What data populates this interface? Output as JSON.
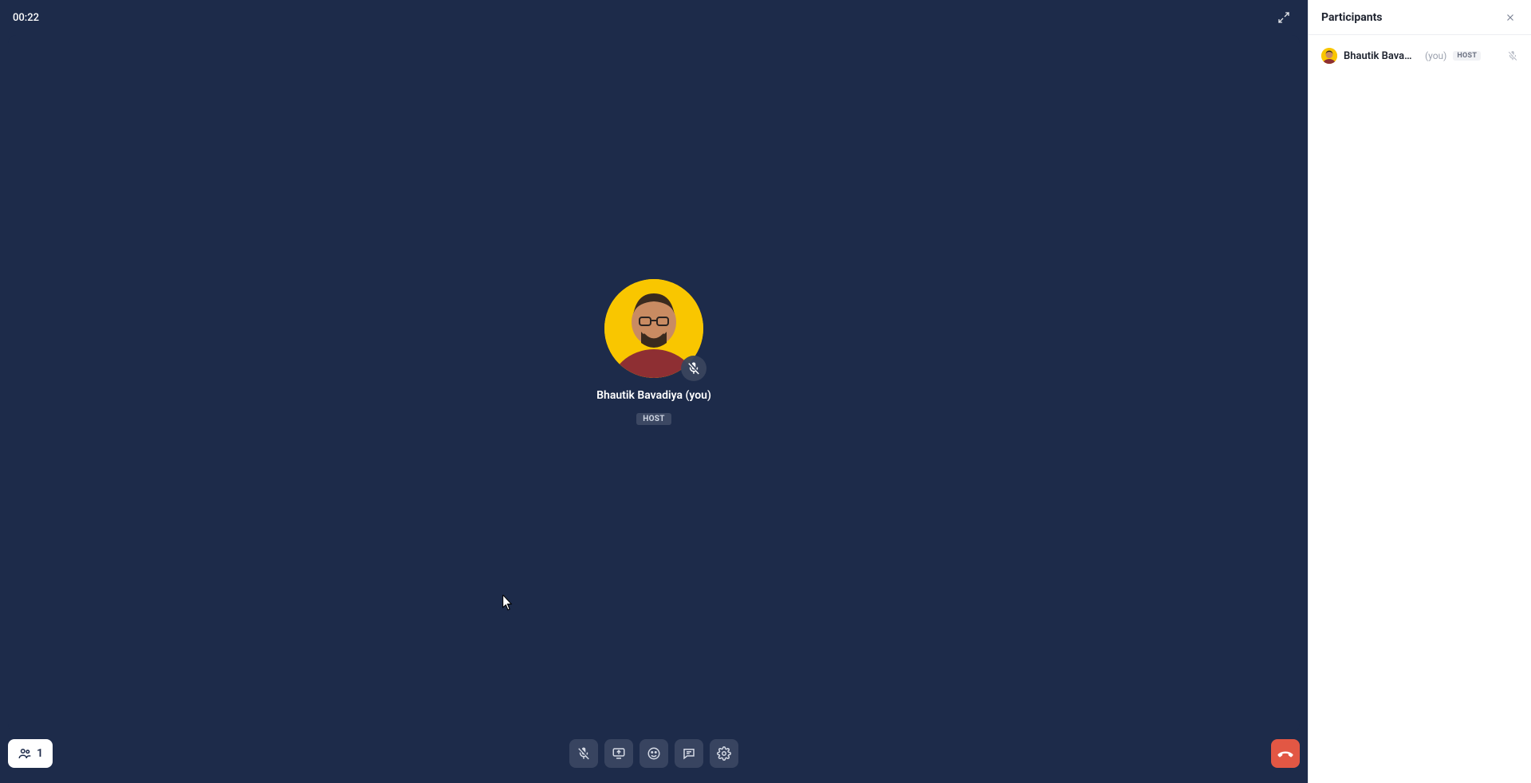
{
  "header": {
    "timer": "00:22"
  },
  "stage": {
    "participant": {
      "name_line": "Bhautik Bavadiya (you)",
      "role_chip": "HOST"
    }
  },
  "bottombar": {
    "participant_count": "1"
  },
  "side_panel": {
    "title": "Participants",
    "items": [
      {
        "name": "Bhautik Bavad…",
        "you": "(you)",
        "role_chip": "HOST"
      }
    ]
  }
}
